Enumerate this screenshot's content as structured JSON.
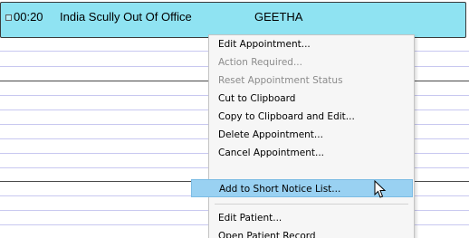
{
  "appointment": {
    "time": "00:20",
    "description": "India Scully Out Of Office",
    "clinician": "GEETHA",
    "color": "#8fe3f2"
  },
  "context_menu": {
    "items": [
      {
        "label": "Edit Appointment...",
        "enabled": true
      },
      {
        "label": "Action Required...",
        "enabled": false
      },
      {
        "label": "Reset Appointment Status",
        "enabled": false
      },
      {
        "label": "Cut to Clipboard",
        "enabled": true
      },
      {
        "label": "Copy to Clipboard and Edit...",
        "enabled": true
      },
      {
        "label": "Delete Appointment...",
        "enabled": true
      },
      {
        "label": "Cancel Appointment...",
        "enabled": true
      },
      {
        "label": "Add to Short Notice List...",
        "enabled": true,
        "highlighted": true
      },
      {
        "label": "Edit Patient...",
        "enabled": true
      },
      {
        "label": "Open Patient Record",
        "enabled": true
      }
    ],
    "highlight_color": "#99d1f2"
  },
  "cursor": {
    "icon": "mouse-pointer-icon"
  }
}
